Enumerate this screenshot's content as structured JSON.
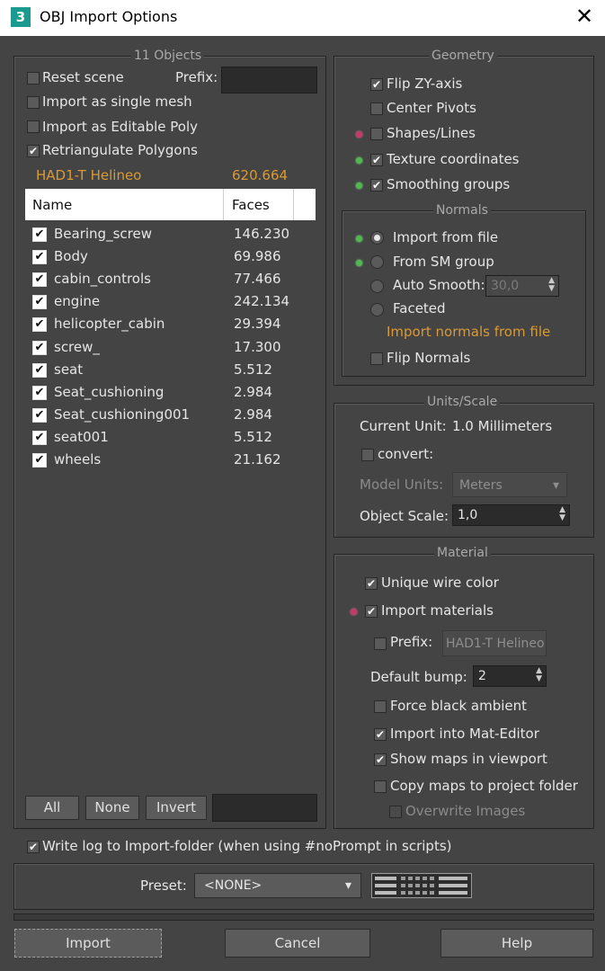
{
  "window": {
    "title": "OBJ Import Options",
    "app_icon": "3",
    "close": "✕"
  },
  "objects": {
    "group_title": "11 Objects",
    "reset_scene": "Reset scene",
    "prefix_label": "Prefix:",
    "single_mesh": "Import as single mesh",
    "editable_poly": "Import as Editable Poly",
    "retriangulate": "Retriangulate Polygons",
    "summary_name": "HAD1-T Helineo",
    "summary_faces": "620.664",
    "col_name": "Name",
    "col_faces": "Faces",
    "rows": [
      {
        "name": "Bearing_screw",
        "faces": "146.230"
      },
      {
        "name": "Body",
        "faces": "69.986"
      },
      {
        "name": "cabin_controls",
        "faces": "77.466"
      },
      {
        "name": "engine",
        "faces": "242.134"
      },
      {
        "name": "helicopter_cabin",
        "faces": "29.394"
      },
      {
        "name": "screw_",
        "faces": "17.300"
      },
      {
        "name": "seat",
        "faces": "5.512"
      },
      {
        "name": "Seat_cushioning",
        "faces": "2.984"
      },
      {
        "name": "Seat_cushioning001",
        "faces": "2.984"
      },
      {
        "name": "seat001",
        "faces": "5.512"
      },
      {
        "name": "wheels",
        "faces": "21.162"
      }
    ],
    "btn_all": "All",
    "btn_none": "None",
    "btn_invert": "Invert"
  },
  "geometry": {
    "group_title": "Geometry",
    "flip_zy": "Flip ZY-axis",
    "center_pivots": "Center Pivots",
    "shapes_lines": "Shapes/Lines",
    "texture_coords": "Texture coordinates",
    "smoothing_groups": "Smoothing groups",
    "normals_title": "Normals",
    "import_from_file": "Import from file",
    "from_sm_group": "From SM group",
    "auto_smooth": "Auto Smooth:",
    "auto_smooth_value": "30,0",
    "faceted": "Faceted",
    "normals_note": "Import normals from file",
    "flip_normals": "Flip Normals"
  },
  "units": {
    "group_title": "Units/Scale",
    "current_unit_label": "Current Unit:",
    "current_unit_value": "1.0 Millimeters",
    "convert": "convert:",
    "model_units_label": "Model Units:",
    "model_units_value": "Meters",
    "object_scale_label": "Object Scale:",
    "object_scale_value": "1,0"
  },
  "material": {
    "group_title": "Material",
    "unique_wire": "Unique wire color",
    "import_materials": "Import materials",
    "prefix_label": "Prefix:",
    "prefix_value": "HAD1-T Helineo",
    "default_bump_label": "Default bump:",
    "default_bump_value": "2",
    "force_black": "Force black ambient",
    "mat_editor": "Import into Mat-Editor",
    "show_maps": "Show maps in viewport",
    "copy_maps": "Copy maps to project folder",
    "overwrite": "Overwrite Images"
  },
  "log": {
    "write_log": "Write log to Import-folder (when using #noPrompt in scripts)"
  },
  "preset": {
    "label": "Preset:",
    "value": "<NONE>"
  },
  "footer": {
    "import": "Import",
    "cancel": "Cancel",
    "help": "Help"
  },
  "glyphs": {
    "check": "✔",
    "dropdown": "▾",
    "spin_up": "▲",
    "spin_down": "▼"
  }
}
